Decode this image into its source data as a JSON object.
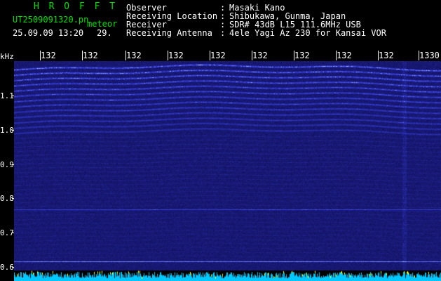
{
  "header": {
    "app_name": "H R O F F T",
    "filename": "UT2509091320.pn",
    "mode": "meteor",
    "datetime": "25.09.09 13:20",
    "counter": "29.",
    "fields": [
      {
        "label": "Observer",
        "value": "Masaki Kano"
      },
      {
        "label": "Receiving Location",
        "value": "Shibukawa, Gunma, Japan"
      },
      {
        "label": "Receiver",
        "value": "SDR# 43dB L15 111.6MHz USB"
      },
      {
        "label": "Receiving Antenna",
        "value": "4ele Yagi Az 230 for Kansai VOR"
      }
    ]
  },
  "y_axis": {
    "unit": "kHz",
    "ticks": [
      {
        "label": "1.1",
        "value": 1.1
      },
      {
        "label": "1.0",
        "value": 1.0
      },
      {
        "label": "0.9",
        "value": 0.9
      },
      {
        "label": "0.8",
        "value": 0.8
      },
      {
        "label": "0.7",
        "value": 0.7
      },
      {
        "label": "0.6",
        "value": 0.6
      }
    ],
    "range": [
      0.59,
      1.2
    ]
  },
  "x_axis": {
    "ticks": [
      "132",
      "132",
      "132",
      "132",
      "132",
      "132",
      "132",
      "132",
      "132",
      "1330"
    ]
  },
  "colors": {
    "background": "#000000",
    "header_text": "#ffffff",
    "accent_green": "#00e000",
    "waterfall_base": "#0a0a5a",
    "waterfall_trace": "#4a6cff",
    "spectrum": "#00c8ff",
    "spectrum_peak": "#ffff00"
  }
}
